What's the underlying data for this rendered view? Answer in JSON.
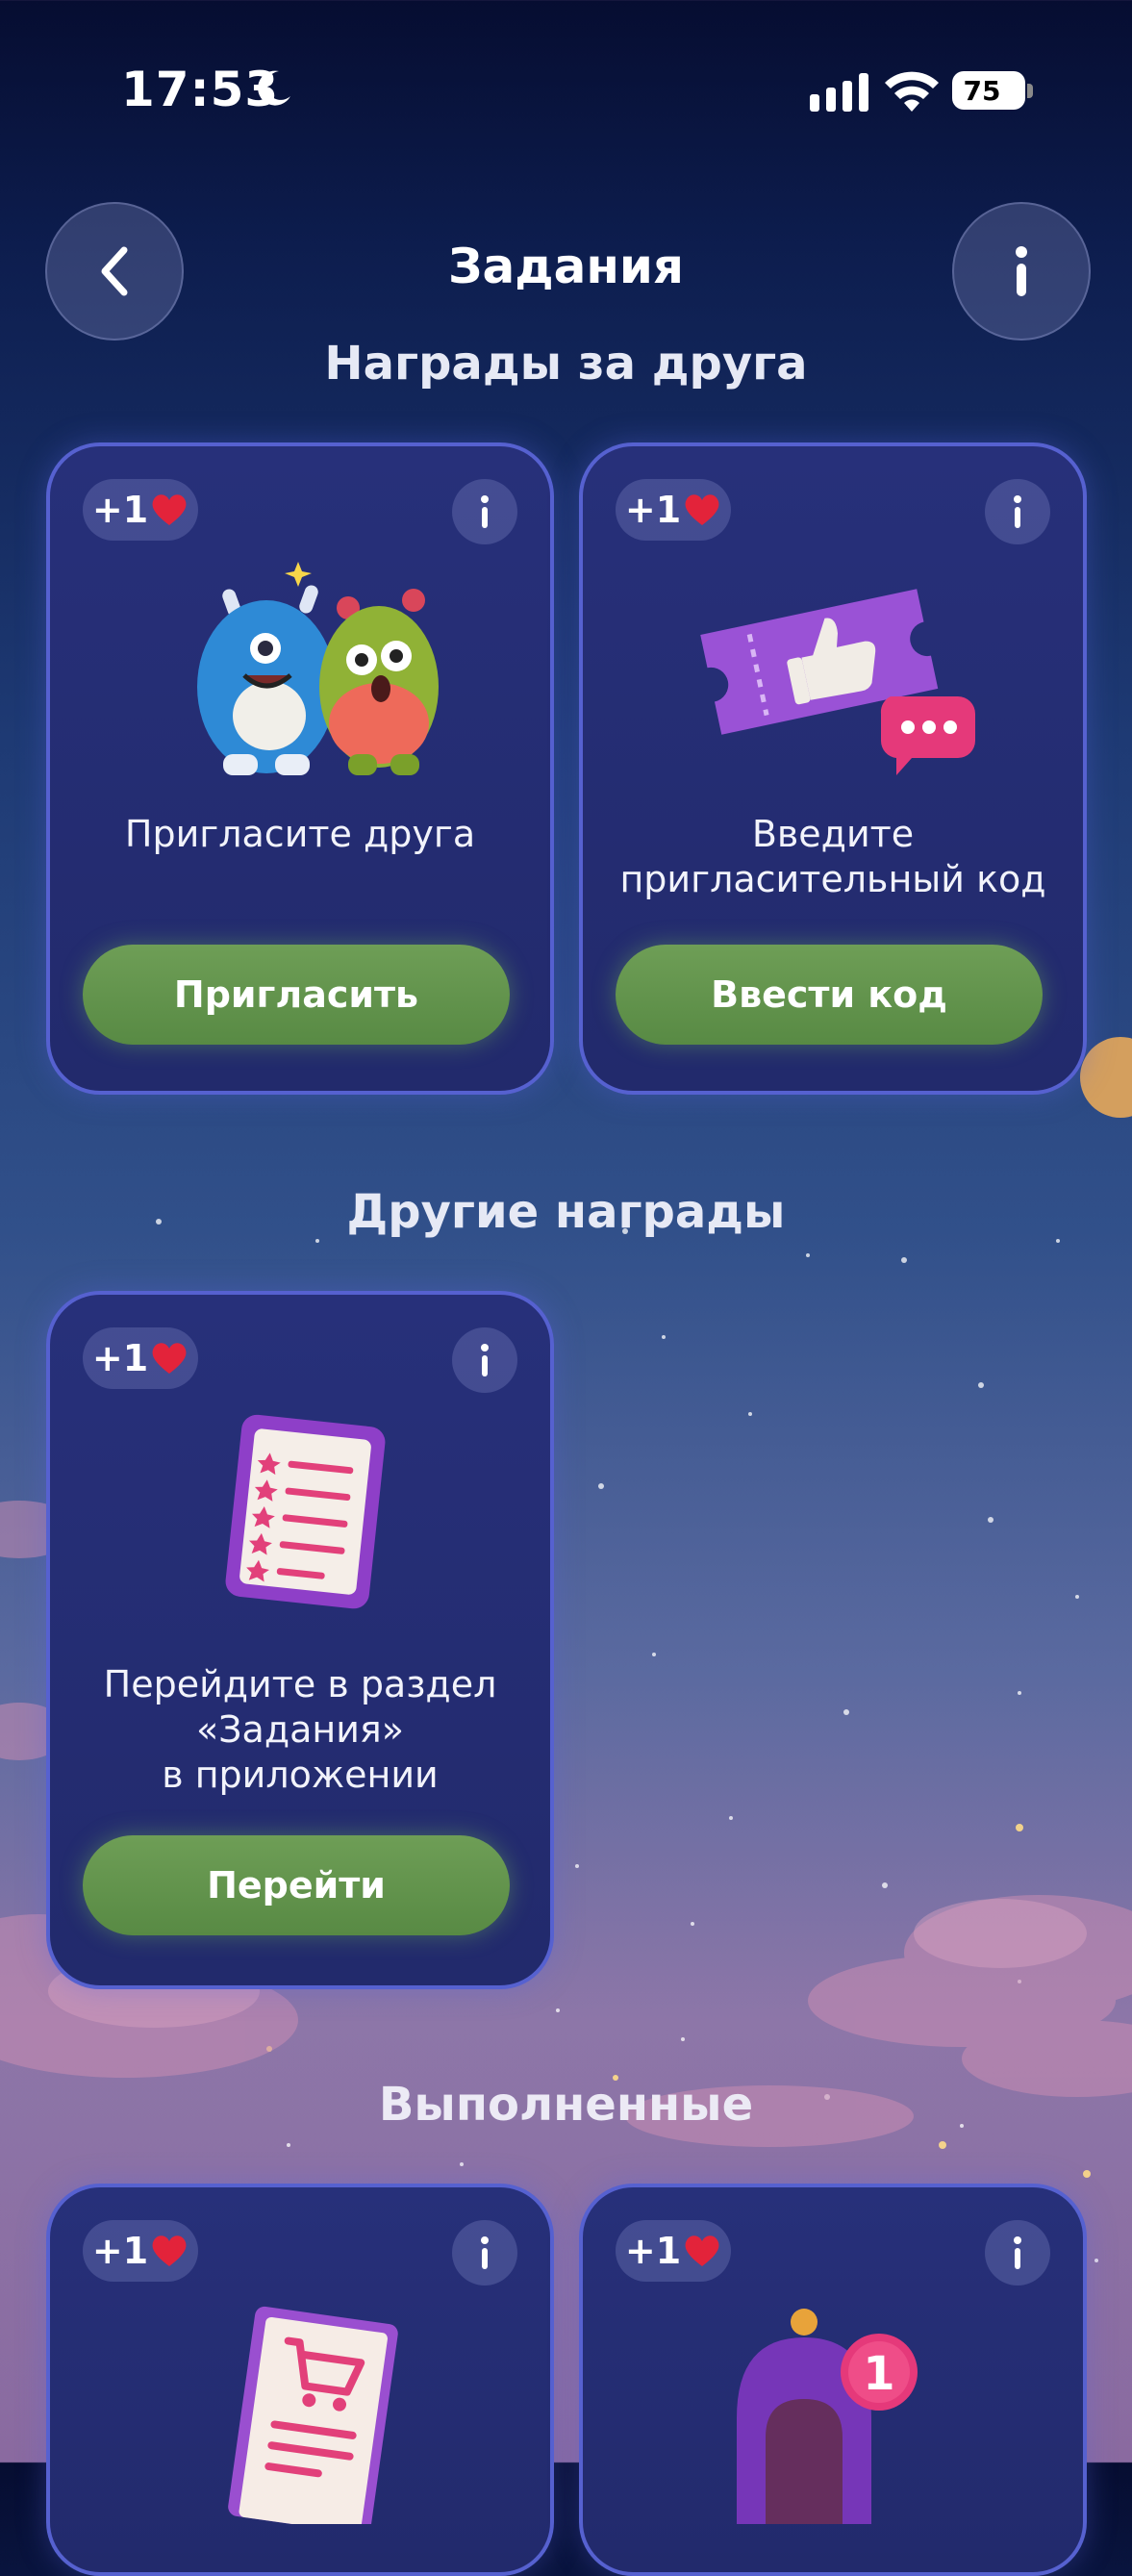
{
  "status_bar": {
    "time": "17:53",
    "battery": "75"
  },
  "header": {
    "title": "Задания"
  },
  "sections": [
    {
      "title": "Награды за друга"
    },
    {
      "title": "Другие награды"
    },
    {
      "title": "Выполненные"
    }
  ],
  "cards": [
    {
      "reward": "+1",
      "text": "Пригласите друга",
      "button": "Пригласить"
    },
    {
      "reward": "+1",
      "text": "Введите\nпригласительный код",
      "button": "Ввести код"
    },
    {
      "reward": "+1",
      "text": "Перейдите в раздел\n«Задания»\nв приложении",
      "button": "Перейти"
    },
    {
      "reward": "+1"
    },
    {
      "reward": "+1",
      "notification_count": "1"
    }
  ],
  "colors": {
    "card_background": "#27307a",
    "card_border": "#5661d0",
    "button_green": "#6e9e56",
    "heart_red": "#e3233a"
  }
}
